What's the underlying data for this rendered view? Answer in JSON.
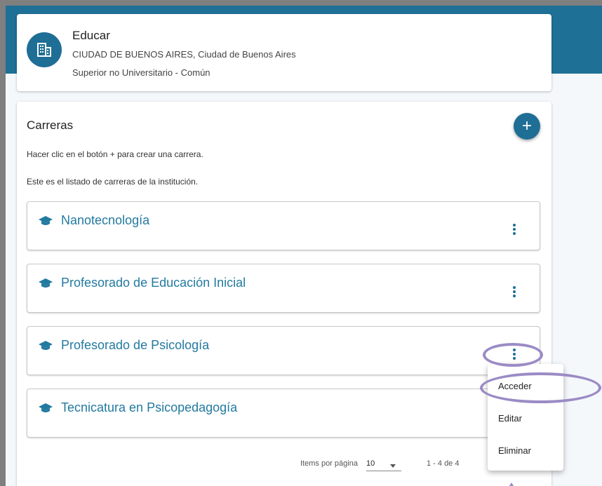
{
  "institution": {
    "name": "Educar",
    "location": "CIUDAD DE BUENOS AIRES, Ciudad de Buenos Aires",
    "level": "Superior no Universitario - Común"
  },
  "careers_section": {
    "title": "Carreras",
    "add_button_label": "+",
    "hint": "Hacer clic en el botón + para crear una carrera.",
    "description": "Este es el listado de carreras de la institución.",
    "items": [
      {
        "name": "Nanotecnología"
      },
      {
        "name": "Profesorado de Educación Inicial"
      },
      {
        "name": "Profesorado de Psicología"
      },
      {
        "name": "Tecnicatura en Psicopedagogía"
      }
    ]
  },
  "context_menu": {
    "items": [
      "Acceder",
      "Editar",
      "Eliminar"
    ]
  },
  "pagination": {
    "items_per_page_label": "Items por página",
    "page_size": "10",
    "range": "1 - 4 de 4",
    "prev": "‹",
    "next": "›"
  },
  "colors": {
    "primary": "#1f6e96",
    "link": "#237aa0",
    "annotation": "#9b8bc5"
  }
}
